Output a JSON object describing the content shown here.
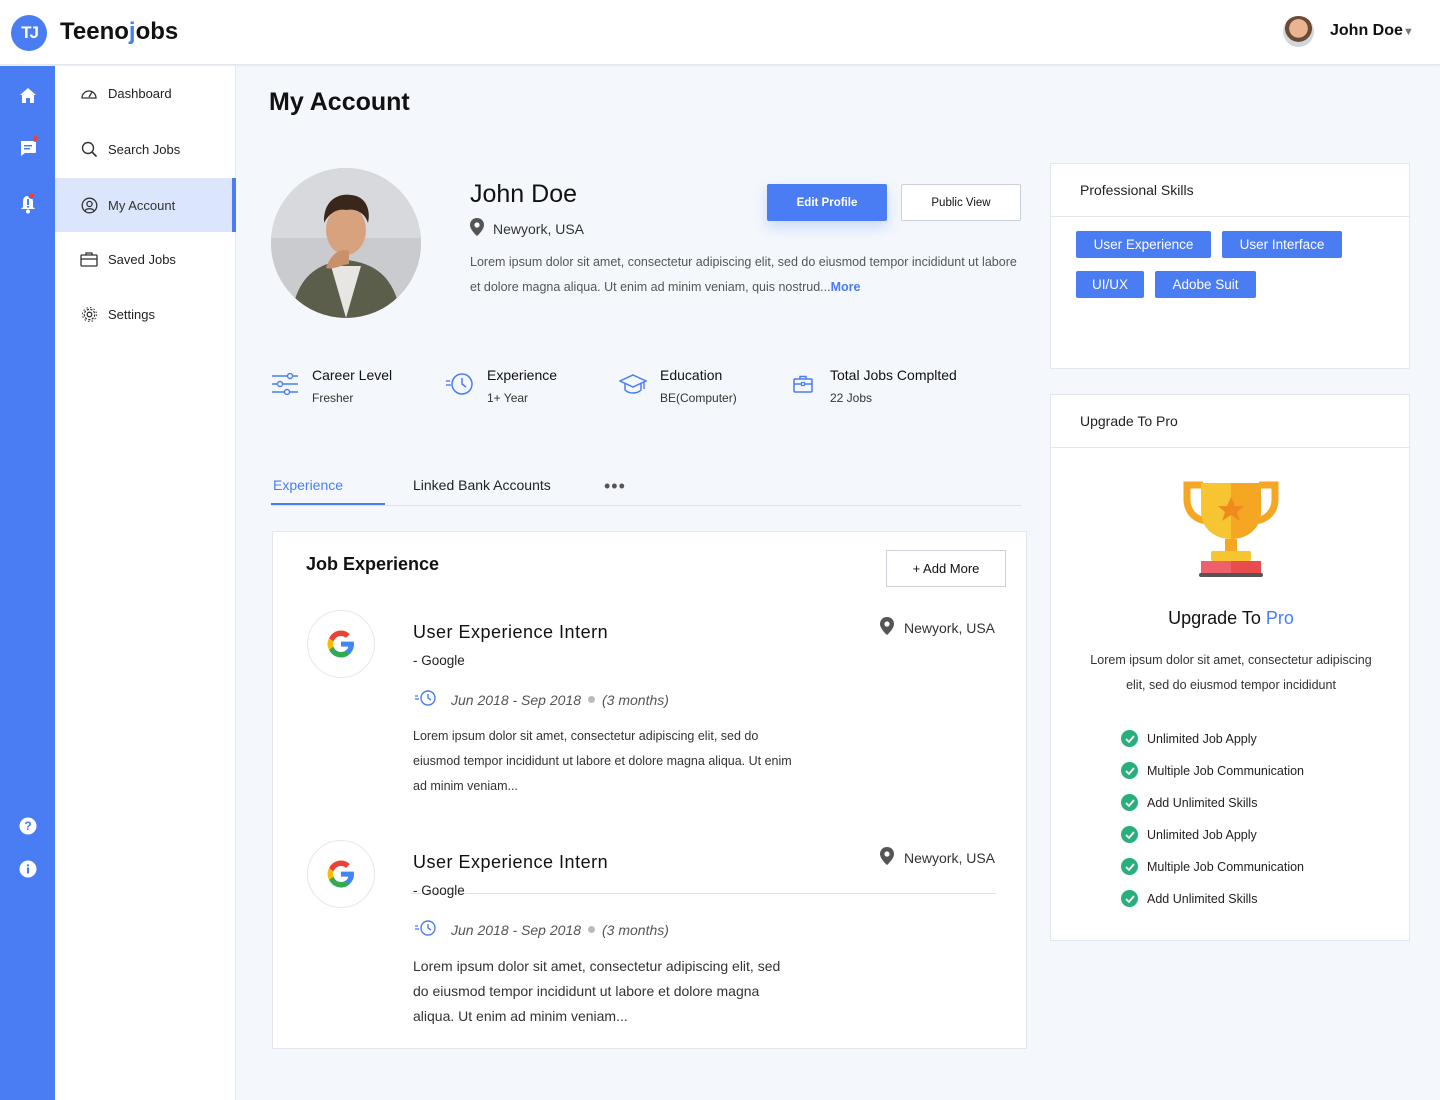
{
  "header": {
    "logo_badge": "TJ",
    "logo_pre": "Teeno",
    "logo_accent": "j",
    "logo_post": "obs",
    "user_name": "John Doe",
    "caret": "▼"
  },
  "rail": {
    "items": [
      "home-icon",
      "chat-icon",
      "bell-icon",
      "help-icon",
      "info-icon"
    ],
    "badge_color": "#ff3b30"
  },
  "sidebar": {
    "items": [
      {
        "label": "Dashboard",
        "icon": "gauge-icon"
      },
      {
        "label": "Search Jobs",
        "icon": "search-icon"
      },
      {
        "label": "My Account",
        "icon": "user-circle-icon",
        "active": true
      },
      {
        "label": "Saved Jobs",
        "icon": "briefcase-icon"
      },
      {
        "label": "Settings",
        "icon": "gear-icon"
      }
    ]
  },
  "page": {
    "title": "My Account"
  },
  "profile": {
    "name": "John Doe",
    "location": "Newyork, USA",
    "bio": "Lorem ipsum dolor sit amet, consectetur adipiscing elit, sed do eiusmod tempor incididunt ut labore et dolore magna aliqua. Ut enim ad minim veniam, quis nostrud...",
    "more": "More",
    "edit_button": "Edit Profile",
    "public_button": "Public View"
  },
  "stats": [
    {
      "label": "Career Level",
      "value": "Fresher",
      "icon": "sliders-icon"
    },
    {
      "label": "Experience",
      "value": "1+ Year",
      "icon": "clock-icon"
    },
    {
      "label": "Education",
      "value": "BE(Computer)",
      "icon": "graduation-cap-icon"
    },
    {
      "label": "Total Jobs Complted",
      "value": "22 Jobs",
      "icon": "briefcase-icon"
    }
  ],
  "tabs": [
    {
      "label": "Experience",
      "active": true
    },
    {
      "label": "Linked Bank Accounts"
    }
  ],
  "tabs_more": "•••",
  "experience": {
    "title": "Job Experience",
    "add_button": "+ Add More",
    "jobs": [
      {
        "title": "User Experience Intern",
        "company": "- Google",
        "location": "Newyork, USA",
        "dates": "Jun 2018 - Sep 2018",
        "duration": "(3 months)",
        "description": "Lorem ipsum dolor sit amet, consectetur adipiscing elit, sed do eiusmod tempor incididunt ut labore et dolore magna aliqua. Ut enim ad minim veniam..."
      },
      {
        "title": "User Experience Intern",
        "company": "- Google",
        "location": "Newyork, USA",
        "dates": "Jun 2018 - Sep 2018",
        "duration": "(3 months)",
        "description": "Lorem ipsum dolor sit amet, consectetur adipiscing elit, sed do eiusmod tempor incididunt ut labore et dolore magna aliqua. Ut enim ad minim veniam..."
      }
    ]
  },
  "skills": {
    "title": "Professional Skills",
    "items": [
      "User Experience",
      "User Interface",
      "UI/UX",
      "Adobe Suit"
    ]
  },
  "upgrade": {
    "panel_title": "Upgrade To Pro",
    "heading_pre": "Upgrade To ",
    "heading_accent": "Pro",
    "text": "Lorem ipsum dolor sit amet, consectetur adipiscing elit, sed do eiusmod tempor incididunt",
    "features": [
      "Unlimited Job Apply",
      "Multiple Job Communication",
      "Add Unlimited Skills",
      "Unlimited Job Apply",
      "Multiple Job Communication",
      "Add Unlimited Skills"
    ]
  },
  "colors": {
    "accent": "#4a7df3",
    "check": "#27b07c",
    "page_bg": "#f4f8fc"
  }
}
